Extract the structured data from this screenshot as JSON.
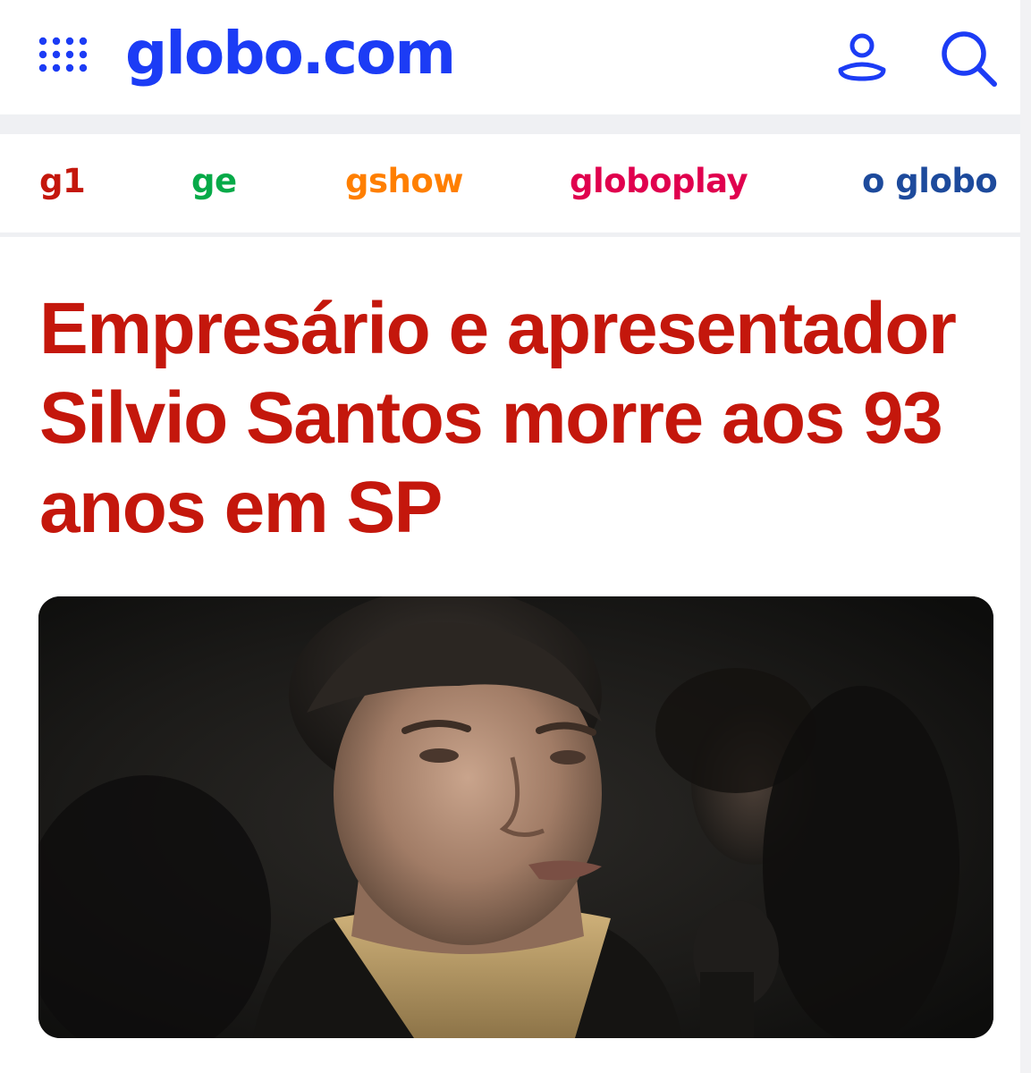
{
  "header": {
    "logo": "globo.com",
    "menu_icon": "apps-grid-icon",
    "user_icon": "user-icon",
    "search_icon": "search-icon"
  },
  "nav": {
    "items": [
      {
        "label": "g1",
        "color": "#c4170c"
      },
      {
        "label": "ge",
        "color": "#06aa48"
      },
      {
        "label": "gshow",
        "color": "#ff7f00"
      },
      {
        "label": "globoplay",
        "color": "#e0004e"
      },
      {
        "label": "o globo",
        "color": "#1d4a9c"
      }
    ]
  },
  "article": {
    "headline": "Empresário e apresentador Silvio Santos morre aos 93 anos em SP"
  },
  "colors": {
    "brand_blue": "#1c3cf5",
    "headline_red": "#c4170c"
  }
}
